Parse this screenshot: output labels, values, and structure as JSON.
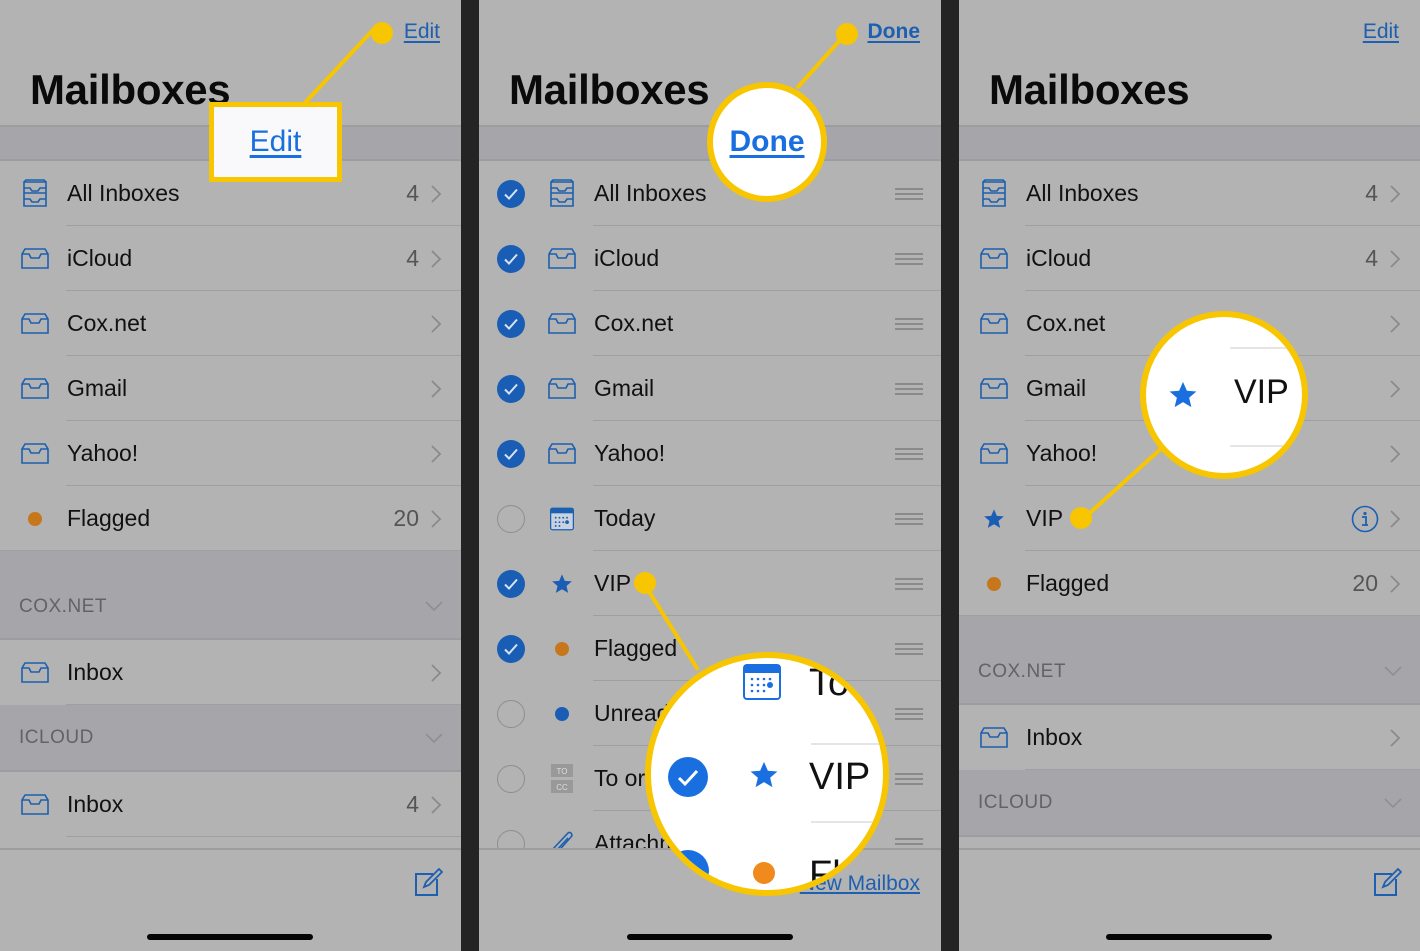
{
  "colors": {
    "accent": "#1d5fb0",
    "accent_highlight": "#1a6fe0",
    "callout": "#f7c600",
    "flag_orange": "#c7771b",
    "background": "#b3b3b3",
    "section_bg": "#a6a6aa"
  },
  "panel1": {
    "nav_button": "Edit",
    "title": "Mailboxes",
    "callout_label": "Edit",
    "rows": [
      {
        "icon": "all-inboxes-icon",
        "label": "All Inboxes",
        "count": "4"
      },
      {
        "icon": "inbox-icon",
        "label": "iCloud",
        "count": "4"
      },
      {
        "icon": "inbox-icon",
        "label": "Cox.net",
        "count": ""
      },
      {
        "icon": "inbox-icon",
        "label": "Gmail",
        "count": ""
      },
      {
        "icon": "inbox-icon",
        "label": "Yahoo!",
        "count": ""
      },
      {
        "icon": "flag-dot-icon",
        "label": "Flagged",
        "count": "20"
      }
    ],
    "sections": [
      {
        "title": "COX.NET",
        "rows": [
          {
            "icon": "inbox-icon",
            "label": "Inbox",
            "count": ""
          }
        ]
      },
      {
        "title": "ICLOUD",
        "rows": [
          {
            "icon": "inbox-icon",
            "label": "Inbox",
            "count": "4"
          }
        ]
      }
    ]
  },
  "panel2": {
    "nav_button": "Done",
    "title": "Mailboxes",
    "callout_label": "Done",
    "rows": [
      {
        "checked": true,
        "icon": "all-inboxes-icon",
        "label": "All Inboxes"
      },
      {
        "checked": true,
        "icon": "inbox-icon",
        "label": "iCloud"
      },
      {
        "checked": true,
        "icon": "inbox-icon",
        "label": "Cox.net"
      },
      {
        "checked": true,
        "icon": "inbox-icon",
        "label": "Gmail"
      },
      {
        "checked": true,
        "icon": "inbox-icon",
        "label": "Yahoo!"
      },
      {
        "checked": false,
        "icon": "calendar-icon",
        "label": "Today"
      },
      {
        "checked": true,
        "icon": "star-icon",
        "label": "VIP"
      },
      {
        "checked": true,
        "icon": "flag-dot-icon",
        "label": "Flagged"
      },
      {
        "checked": false,
        "icon": "unread-dot-icon",
        "label": "Unread"
      },
      {
        "checked": false,
        "icon": "to-cc-icon",
        "label": "To or CC"
      },
      {
        "checked": false,
        "icon": "paperclip-icon",
        "label": "Attachments"
      }
    ],
    "new_mailbox": "New Mailbox",
    "magnifier": {
      "top_label": "To",
      "vip_label": "VIP",
      "bottom_label": "Fl"
    }
  },
  "panel3": {
    "nav_button": "Edit",
    "title": "Mailboxes",
    "rows": [
      {
        "icon": "all-inboxes-icon",
        "label": "All Inboxes",
        "count": "4"
      },
      {
        "icon": "inbox-icon",
        "label": "iCloud",
        "count": "4"
      },
      {
        "icon": "inbox-icon",
        "label": "Cox.net",
        "count": ""
      },
      {
        "icon": "inbox-icon",
        "label": "Gmail",
        "count": ""
      },
      {
        "icon": "inbox-icon",
        "label": "Yahoo!",
        "count": ""
      },
      {
        "icon": "star-icon",
        "label": "VIP",
        "count": "",
        "info": true
      },
      {
        "icon": "flag-dot-icon",
        "label": "Flagged",
        "count": "20"
      }
    ],
    "sections": [
      {
        "title": "COX.NET",
        "rows": [
          {
            "icon": "inbox-icon",
            "label": "Inbox",
            "count": ""
          }
        ]
      },
      {
        "title": "ICLOUD",
        "rows": []
      }
    ],
    "magnifier": {
      "vip_label": "VIP"
    }
  }
}
